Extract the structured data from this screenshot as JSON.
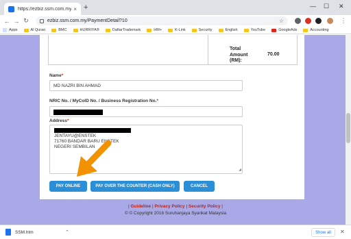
{
  "browser": {
    "tab_title": "https://ezbiz.ssm.com.my/Paym",
    "tab_close": "×",
    "new_tab": "+",
    "url": "ezbiz.ssm.com.my/PaymentDetail?10",
    "window_controls": [
      "—",
      "☐",
      "✕"
    ],
    "bookmarks": [
      {
        "label": "Apps",
        "icon": "apps-grid-icon"
      },
      {
        "label": "Al Quran",
        "icon": "folder-icon"
      },
      {
        "label": "BMC",
        "icon": "folder-icon"
      },
      {
        "label": "HURRIYA®",
        "icon": "folder-icon"
      },
      {
        "label": "DaftarTrademark",
        "icon": "folder-icon"
      },
      {
        "label": "HM+",
        "icon": "folder-icon"
      },
      {
        "label": "K-Link",
        "icon": "folder-icon"
      },
      {
        "label": "Security",
        "icon": "folder-icon"
      },
      {
        "label": "English",
        "icon": "folder-icon"
      },
      {
        "label": "YouTube",
        "icon": "folder-icon"
      },
      {
        "label": "GoogleAds",
        "icon": "youtube-icon"
      },
      {
        "label": "Accounting",
        "icon": "folder-icon"
      }
    ]
  },
  "summary": {
    "total_label": "Total Amount (RM):",
    "total_value": "70.00"
  },
  "form": {
    "name_label": "Name",
    "name_value": "MD NAZRI BIN AHMAD",
    "nric_label": "NRIC No. / MyCoID No. / Business Registration No.",
    "address_label": "Address",
    "address_lines": [
      "JENTAYU@ENSTEK",
      "71760 BANDAR BARU ENSTEK",
      "NEGERI SEMBILAN"
    ],
    "required_mark": "*"
  },
  "buttons": {
    "pay_online": "PAY ONLINE",
    "pay_counter": "PAY OVER THE COUNTER (CASH ONLY)",
    "cancel": "CANCEL"
  },
  "footer": {
    "sep": "|",
    "guideline": "Guideline",
    "privacy": "Privacy Policy",
    "security": "Security Policy",
    "copyright": "© © Copyright 2016 Suruhanjaya Syarikat Malaysia"
  },
  "download": {
    "filename": "SSM.htm",
    "caret": "⌃",
    "show_all": "Show all",
    "close": "✕"
  },
  "colors": {
    "page_bg": "#a9a9e8",
    "button": "#2a8fd6",
    "footer_link": "#b3261e",
    "annotation_arrow": "#f39200"
  }
}
